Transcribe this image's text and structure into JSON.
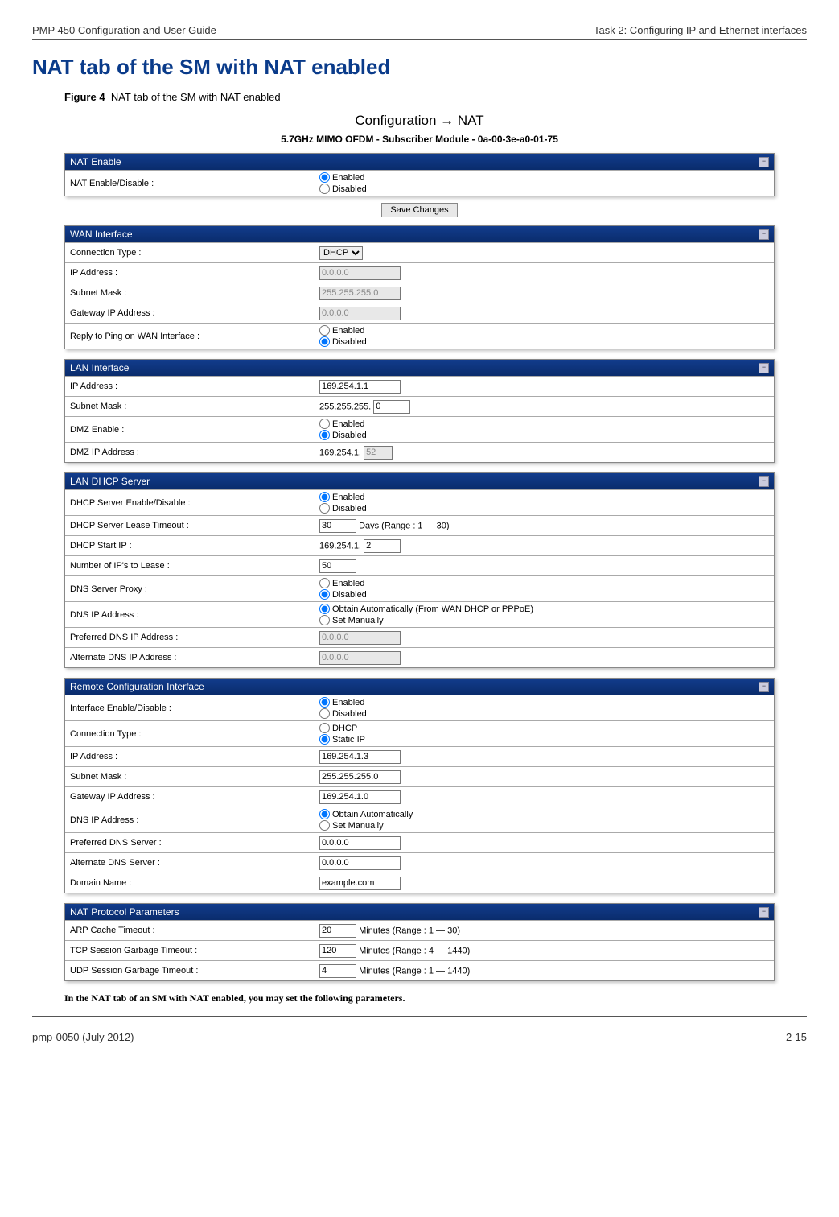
{
  "header": {
    "left": "PMP 450 Configuration and User Guide",
    "right": "Task 2: Configuring IP and Ethernet interfaces"
  },
  "title": "NAT tab of the SM with NAT enabled",
  "figure": {
    "label": "Figure 4",
    "caption": "NAT tab of the SM with NAT enabled"
  },
  "config_title": "Configuration → NAT",
  "device_line": "5.7GHz MIMO OFDM - Subscriber Module - 0a-00-3e-a0-01-75",
  "opt": {
    "enabled": "Enabled",
    "disabled": "Disabled",
    "dhcp": "DHCP",
    "static": "Static IP",
    "obtain_wan": "Obtain Automatically (From WAN DHCP or PPPoE)",
    "obtain_auto": "Obtain Automatically",
    "set_manual": "Set Manually"
  },
  "save_button": "Save Changes",
  "p_nat": {
    "hd": "NAT Enable",
    "r0": "NAT Enable/Disable :"
  },
  "p_wan": {
    "hd": "WAN Interface",
    "r0": "Connection Type :",
    "v0": "DHCP",
    "r1": "IP Address :",
    "v1": "0.0.0.0",
    "r2": "Subnet Mask :",
    "v2": "255.255.255.0",
    "r3": "Gateway IP Address :",
    "v3": "0.0.0.0",
    "r4": "Reply to Ping on WAN Interface :"
  },
  "p_lan": {
    "hd": "LAN Interface",
    "r0": "IP Address :",
    "v0": "169.254.1.1",
    "r1": "Subnet Mask :",
    "v1_pref": "255.255.255.",
    "v1_oct": "0",
    "r2": "DMZ Enable :",
    "r3": "DMZ IP Address :",
    "v3_pref": "169.254.1.",
    "v3_oct": "52"
  },
  "p_dhcp": {
    "hd": "LAN DHCP Server",
    "r0": "DHCP Server Enable/Disable :",
    "r1": "DHCP Server Lease Timeout :",
    "v1": "30",
    "v1_suf": "Days (Range : 1 — 30)",
    "r2": "DHCP Start IP :",
    "v2_pref": "169.254.1.",
    "v2_oct": "2",
    "r3": "Number of IP's to Lease :",
    "v3": "50",
    "r4": "DNS Server Proxy :",
    "r5": "DNS IP Address :",
    "r6": "Preferred DNS IP Address :",
    "v6": "0.0.0.0",
    "r7": "Alternate DNS IP Address :",
    "v7": "0.0.0.0"
  },
  "p_rci": {
    "hd": "Remote Configuration Interface",
    "r0": "Interface Enable/Disable :",
    "r1": "Connection Type :",
    "r2": "IP Address :",
    "v2": "169.254.1.3",
    "r3": "Subnet Mask :",
    "v3": "255.255.255.0",
    "r4": "Gateway IP Address :",
    "v4": "169.254.1.0",
    "r5": "DNS IP Address :",
    "r6": "Preferred DNS Server :",
    "v6": "0.0.0.0",
    "r7": "Alternate DNS Server :",
    "v7": "0.0.0.0",
    "r8": "Domain Name :",
    "v8": "example.com"
  },
  "p_proto": {
    "hd": "NAT Protocol Parameters",
    "r0": "ARP Cache Timeout :",
    "v0": "20",
    "s0": "Minutes (Range : 1 — 30)",
    "r1": "TCP Session Garbage Timeout :",
    "v1": "120",
    "s1": "Minutes (Range : 4 — 1440)",
    "r2": "UDP Session Garbage Timeout :",
    "v2": "4",
    "s2": "Minutes (Range : 1 — 1440)"
  },
  "body_text": "In the NAT tab of an SM with NAT enabled, you may set the following parameters.",
  "footer": {
    "left": "pmp-0050 (July 2012)",
    "right": "2-15"
  }
}
